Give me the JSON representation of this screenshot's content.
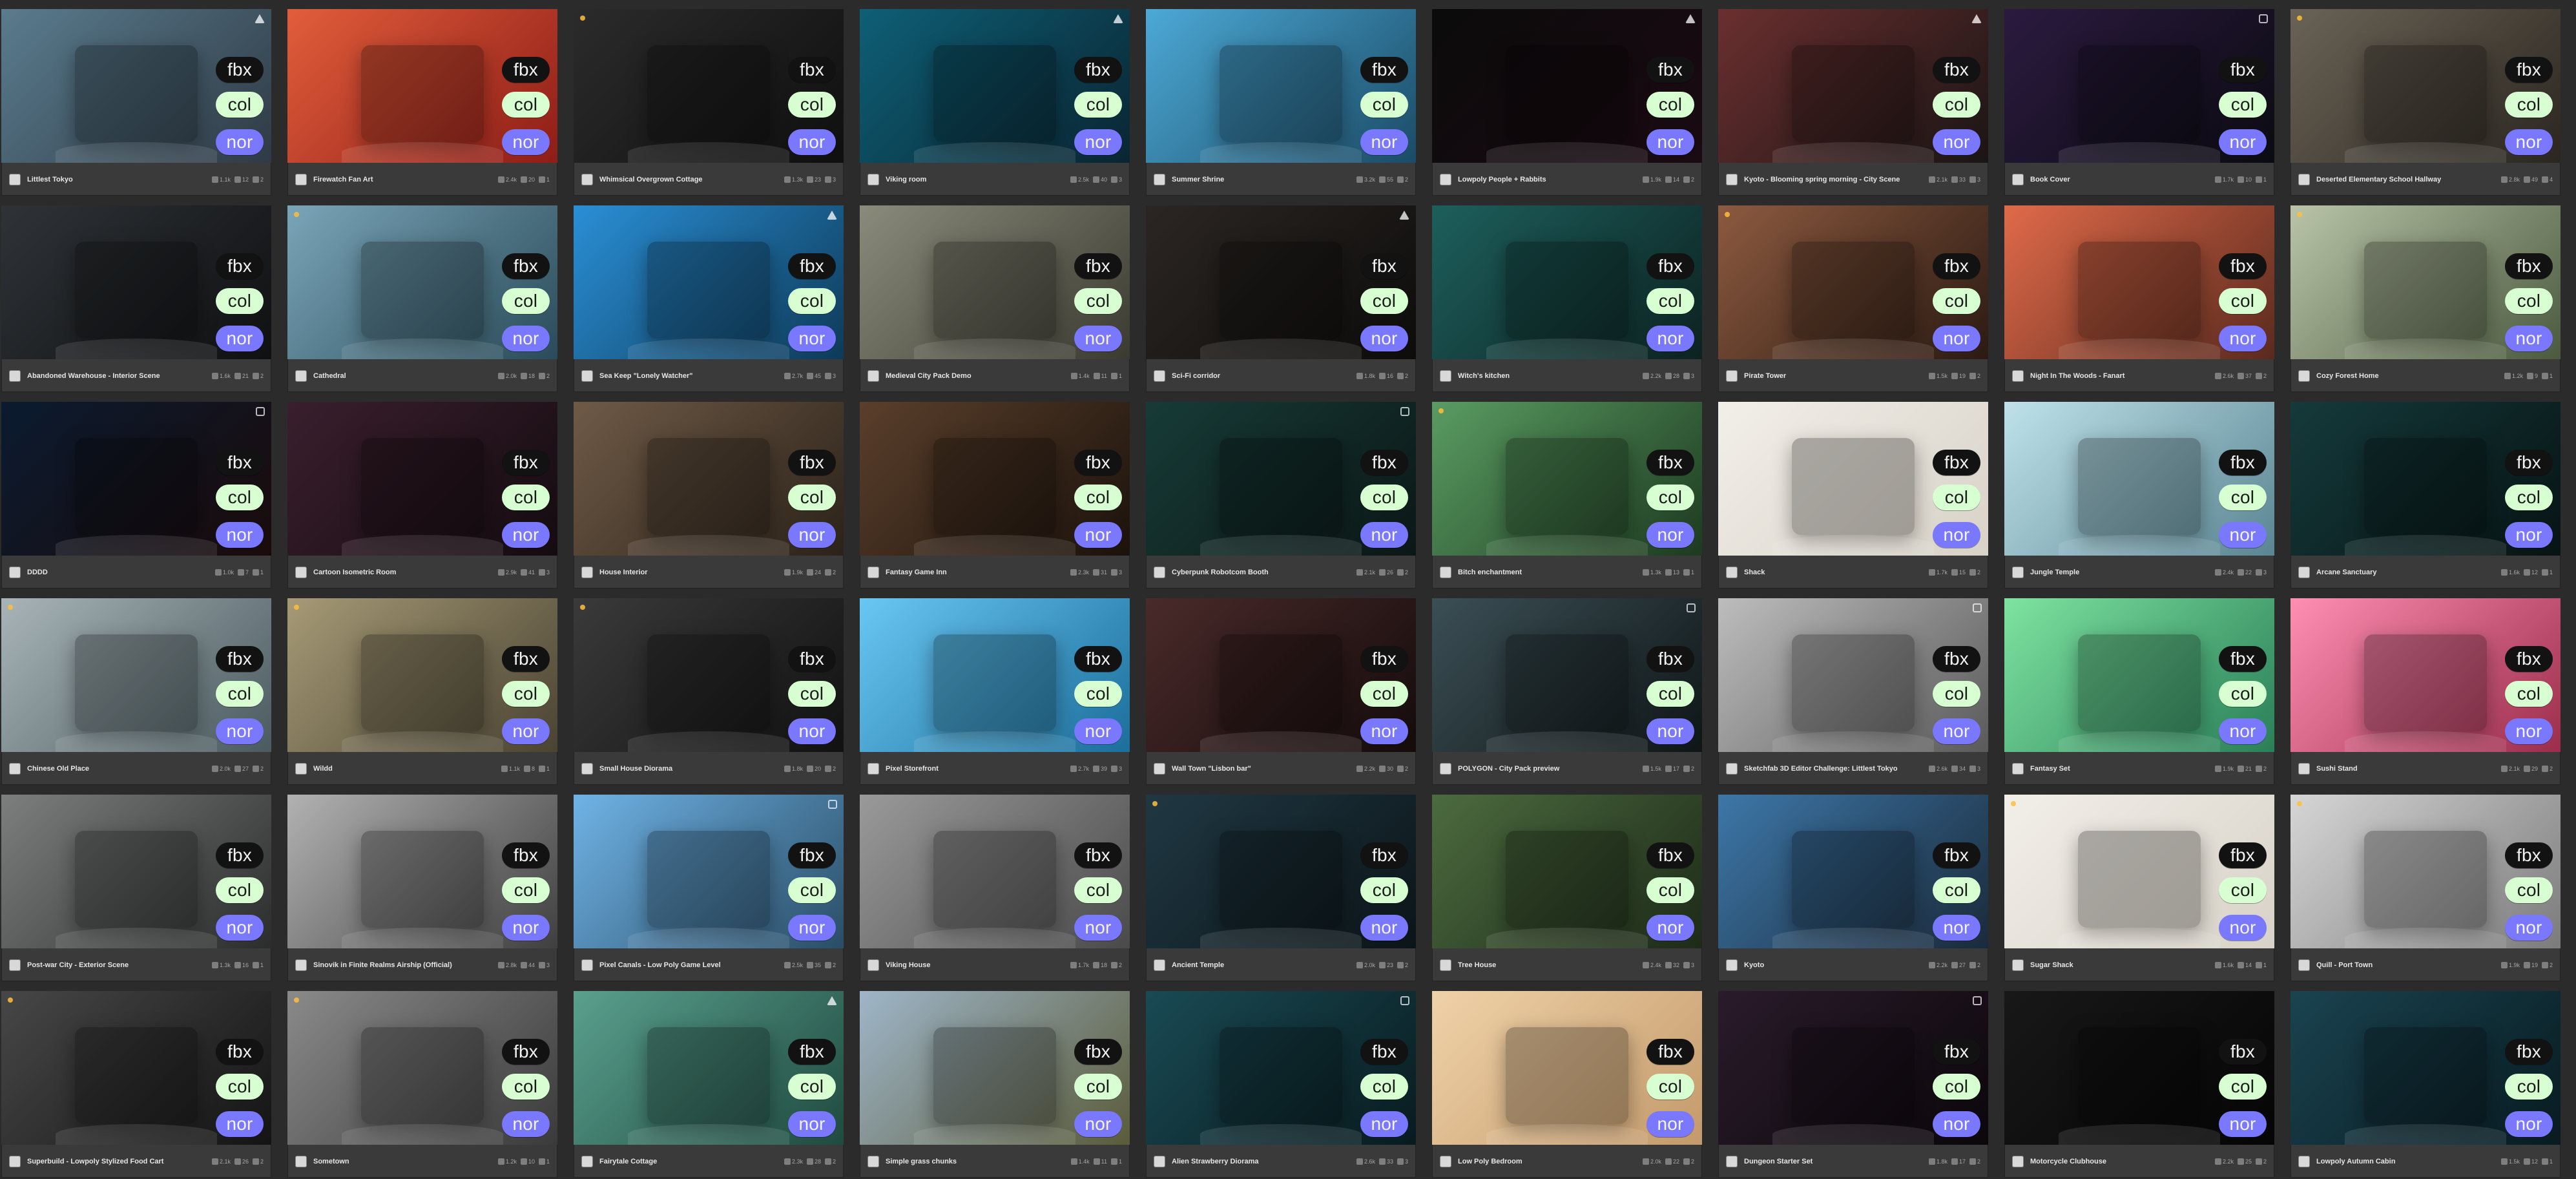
{
  "labels": {
    "fbx": "fbx",
    "col": "col",
    "nor": "nor"
  },
  "palette": {
    "card_bg": "#3a3a3a",
    "pill_fbx_bg": "#121212",
    "pill_col_bg": "#d7ffd1",
    "pill_nor_bg": "#7a78ff"
  },
  "cards": [
    {
      "title": "Littlest Tokyo",
      "colors": [
        "#5a7c8e",
        "#2f3a45"
      ],
      "stats": [
        "1.1k",
        "12",
        "2"
      ],
      "corner": "tri"
    },
    {
      "title": "Firewatch Fan Art",
      "colors": [
        "#e25d3b",
        "#8d1d17"
      ],
      "stats": [
        "2.4k",
        "20",
        "1"
      ],
      "corner": "none"
    },
    {
      "title": "Whimsical Overgrown Cottage",
      "colors": [
        "#2b2b2b",
        "#0f0f0f"
      ],
      "stats": [
        "1.3k",
        "23",
        "3"
      ],
      "corner": "dot"
    },
    {
      "title": "Viking room",
      "colors": [
        "#0e5f76",
        "#0a2532"
      ],
      "stats": [
        "2.5k",
        "40",
        "3"
      ],
      "corner": "tri"
    },
    {
      "title": "Summer Shrine",
      "colors": [
        "#4ca9d6",
        "#1b4b66"
      ],
      "stats": [
        "3.2k",
        "55",
        "2"
      ],
      "corner": "none"
    },
    {
      "title": "Lowpoly People + Rabbits",
      "colors": [
        "#0b0b0b",
        "#1a0a12"
      ],
      "stats": [
        "1.9k",
        "14",
        "2"
      ],
      "corner": "tri"
    },
    {
      "title": "Kyoto - Blooming spring morning - City Scene",
      "colors": [
        "#6b2f2f",
        "#1a1515"
      ],
      "stats": [
        "2.1k",
        "33",
        "3"
      ],
      "corner": "tri"
    },
    {
      "title": "Book Cover",
      "colors": [
        "#2b1a3f",
        "#0b0b12"
      ],
      "stats": [
        "1.7k",
        "10",
        "1"
      ],
      "corner": "box"
    },
    {
      "title": "Deserted Elementary School Hallway",
      "colors": [
        "#6a6356",
        "#2b2620"
      ],
      "stats": [
        "2.8k",
        "49",
        "4"
      ],
      "corner": "dot"
    },
    {
      "title": "Abandoned Warehouse - Interior Scene",
      "colors": [
        "#2f3337",
        "#0f1012"
      ],
      "stats": [
        "1.6k",
        "21",
        "2"
      ],
      "corner": "none"
    },
    {
      "title": "Cathedral",
      "colors": [
        "#7aa5b8",
        "#2a4b59"
      ],
      "stats": [
        "2.0k",
        "18",
        "2"
      ],
      "corner": "dot"
    },
    {
      "title": "Sea Keep \"Lonely Watcher\"",
      "colors": [
        "#2a8fd6",
        "#0e3a58"
      ],
      "stats": [
        "2.7k",
        "45",
        "3"
      ],
      "corner": "tri"
    },
    {
      "title": "Medieval City Pack Demo",
      "colors": [
        "#8a8b7b",
        "#3b3a31"
      ],
      "stats": [
        "1.4k",
        "11",
        "1"
      ],
      "corner": "none"
    },
    {
      "title": "Sci-Fi corridor",
      "colors": [
        "#2b2623",
        "#0d0c0b"
      ],
      "stats": [
        "1.8k",
        "16",
        "2"
      ],
      "corner": "tri"
    },
    {
      "title": "Witch's kitchen",
      "colors": [
        "#1d5f5c",
        "#0c2221"
      ],
      "stats": [
        "2.2k",
        "28",
        "3"
      ],
      "corner": "none"
    },
    {
      "title": "Pirate Tower",
      "colors": [
        "#8c5a3f",
        "#2b1a13"
      ],
      "stats": [
        "1.5k",
        "19",
        "2"
      ],
      "corner": "dot"
    },
    {
      "title": "Night In The Woods - Fanart",
      "colors": [
        "#e06a49",
        "#5a2a1e"
      ],
      "stats": [
        "2.6k",
        "37",
        "2"
      ],
      "corner": "none"
    },
    {
      "title": "Cozy Forest Home",
      "colors": [
        "#b9c4a8",
        "#4b5a3f"
      ],
      "stats": [
        "1.2k",
        "9",
        "1"
      ],
      "corner": "dot"
    },
    {
      "title": "DDDD",
      "colors": [
        "#0b1b30",
        "#1a0b0b"
      ],
      "stats": [
        "1.0k",
        "7",
        "1"
      ],
      "corner": "box"
    },
    {
      "title": "Cartoon Isometric Room",
      "colors": [
        "#3a1f2d",
        "#140b10"
      ],
      "stats": [
        "2.9k",
        "41",
        "3"
      ],
      "corner": "none"
    },
    {
      "title": "House Interior",
      "colors": [
        "#6f5a47",
        "#2b2219"
      ],
      "stats": [
        "1.9k",
        "24",
        "2"
      ],
      "corner": "none"
    },
    {
      "title": "Fantasy Game Inn",
      "colors": [
        "#5a3f2b",
        "#1b120c"
      ],
      "stats": [
        "2.3k",
        "31",
        "3"
      ],
      "corner": "none"
    },
    {
      "title": "Cyberpunk Robotcom Booth",
      "colors": [
        "#173b37",
        "#0b1716"
      ],
      "stats": [
        "2.1k",
        "26",
        "2"
      ],
      "corner": "box"
    },
    {
      "title": "Bitch enchantment",
      "colors": [
        "#5a9c62",
        "#1d3a20"
      ],
      "stats": [
        "1.3k",
        "13",
        "1"
      ],
      "corner": "dot"
    },
    {
      "title": "Shack",
      "colors": [
        "#f2efe9",
        "#d8d2c8"
      ],
      "stats": [
        "1.7k",
        "15",
        "2"
      ],
      "corner": "none"
    },
    {
      "title": "Jungle Temple",
      "colors": [
        "#bfe2ea",
        "#5a8592"
      ],
      "stats": [
        "2.4k",
        "22",
        "3"
      ],
      "corner": "none"
    },
    {
      "title": "Arcane Sanctuary",
      "colors": [
        "#153a3b",
        "#071314"
      ],
      "stats": [
        "1.6k",
        "12",
        "1"
      ],
      "corner": "none"
    },
    {
      "title": "Chinese Old Place",
      "colors": [
        "#a8b4b8",
        "#4a5a5f"
      ],
      "stats": [
        "2.0k",
        "27",
        "2"
      ],
      "corner": "dot"
    },
    {
      "title": "Wildd",
      "colors": [
        "#a69a76",
        "#4a4332"
      ],
      "stats": [
        "1.1k",
        "8",
        "1"
      ],
      "corner": "dot"
    },
    {
      "title": "Small House Diorama",
      "colors": [
        "#3a3a3a",
        "#111111"
      ],
      "stats": [
        "1.8k",
        "20",
        "2"
      ],
      "corner": "dot"
    },
    {
      "title": "Pixel Storefront",
      "colors": [
        "#69c7f2",
        "#1c6e9b"
      ],
      "stats": [
        "2.7k",
        "39",
        "3"
      ],
      "corner": "none"
    },
    {
      "title": "Wall Town \"Lisbon bar\"",
      "colors": [
        "#4a2a2a",
        "#140b0b"
      ],
      "stats": [
        "2.2k",
        "30",
        "2"
      ],
      "corner": "none"
    },
    {
      "title": "POLYGON - City Pack preview",
      "colors": [
        "#3b4f55",
        "#0f1517"
      ],
      "stats": [
        "1.5k",
        "17",
        "2"
      ],
      "corner": "box"
    },
    {
      "title": "Sketchfab 3D Editor Challenge: Littlest Tokyo",
      "colors": [
        "#bdbdbd",
        "#5a5a5a"
      ],
      "stats": [
        "2.6k",
        "34",
        "3"
      ],
      "corner": "box"
    },
    {
      "title": "Fantasy Set",
      "colors": [
        "#7ee3a0",
        "#2a7f58"
      ],
      "stats": [
        "1.9k",
        "21",
        "2"
      ],
      "corner": "none"
    },
    {
      "title": "Sushi Stand",
      "colors": [
        "#ff8fb3",
        "#9b2d4c"
      ],
      "stats": [
        "2.1k",
        "29",
        "2"
      ],
      "corner": "none"
    },
    {
      "title": "Post-war City - Exterior Scene",
      "colors": [
        "#7d7f7f",
        "#2b2d2d"
      ],
      "stats": [
        "1.3k",
        "16",
        "1"
      ],
      "corner": "none"
    },
    {
      "title": "Sinovik in Finite Realms Airship (Official)",
      "colors": [
        "#b2b2b2",
        "#3f3f3f"
      ],
      "stats": [
        "2.8k",
        "44",
        "3"
      ],
      "corner": "none"
    },
    {
      "title": "Pixel Canals - Low Poly Game Level",
      "colors": [
        "#6fb3e6",
        "#2a4d66"
      ],
      "stats": [
        "2.5k",
        "35",
        "2"
      ],
      "corner": "box"
    },
    {
      "title": "Viking House",
      "colors": [
        "#9a9a9a",
        "#4a4a4a"
      ],
      "stats": [
        "1.7k",
        "18",
        "2"
      ],
      "corner": "none"
    },
    {
      "title": "Ancient Temple",
      "colors": [
        "#203843",
        "#0b1418"
      ],
      "stats": [
        "2.0k",
        "23",
        "2"
      ],
      "corner": "dot"
    },
    {
      "title": "Tree House",
      "colors": [
        "#4c6b3f",
        "#1d2a18"
      ],
      "stats": [
        "2.4k",
        "32",
        "3"
      ],
      "corner": "none"
    },
    {
      "title": "Kyoto",
      "colors": [
        "#3d77a8",
        "#1a2a3a"
      ],
      "stats": [
        "2.2k",
        "27",
        "2"
      ],
      "corner": "none"
    },
    {
      "title": "Sugar Shack",
      "colors": [
        "#f2efe9",
        "#d8d2c8"
      ],
      "stats": [
        "1.6k",
        "14",
        "1"
      ],
      "corner": "dot"
    },
    {
      "title": "Quill - Port Town",
      "colors": [
        "#d6d6d6",
        "#7b7b7b"
      ],
      "stats": [
        "1.9k",
        "19",
        "2"
      ],
      "corner": "dot"
    },
    {
      "title": "Superbuild - Lowpoly Stylized Food Cart",
      "colors": [
        "#474747",
        "#141414"
      ],
      "stats": [
        "2.1k",
        "26",
        "2"
      ],
      "corner": "dot"
    },
    {
      "title": "Sometown",
      "colors": [
        "#8a8a8a",
        "#3a3a3a"
      ],
      "stats": [
        "1.2k",
        "10",
        "1"
      ],
      "corner": "dot"
    },
    {
      "title": "Fairytale Cottage",
      "colors": [
        "#5aa08d",
        "#1f4a40"
      ],
      "stats": [
        "2.3k",
        "28",
        "2"
      ],
      "corner": "tri"
    },
    {
      "title": "Simple grass chunks",
      "colors": [
        "#9fb6c9",
        "#5a5b3a"
      ],
      "stats": [
        "1.4k",
        "11",
        "1"
      ],
      "corner": "none"
    },
    {
      "title": "Alien Strawberry Diorama",
      "colors": [
        "#1a4a54",
        "#081b1f"
      ],
      "stats": [
        "2.6k",
        "33",
        "3"
      ],
      "corner": "box"
    },
    {
      "title": "Low Poly Bedroom",
      "colors": [
        "#f0d2a8",
        "#c39a6b"
      ],
      "stats": [
        "2.0k",
        "22",
        "2"
      ],
      "corner": "none"
    },
    {
      "title": "Dungeon Starter Set",
      "colors": [
        "#2a1b2b",
        "#0b070b"
      ],
      "stats": [
        "1.8k",
        "17",
        "2"
      ],
      "corner": "box"
    },
    {
      "title": "Motorcycle Clubhouse",
      "colors": [
        "#181818",
        "#050505"
      ],
      "stats": [
        "2.2k",
        "25",
        "2"
      ],
      "corner": "none"
    },
    {
      "title": "Lowpoly Autumn Cabin",
      "colors": [
        "#1a4350",
        "#081b21"
      ],
      "stats": [
        "1.5k",
        "12",
        "1"
      ],
      "corner": "none"
    }
  ]
}
